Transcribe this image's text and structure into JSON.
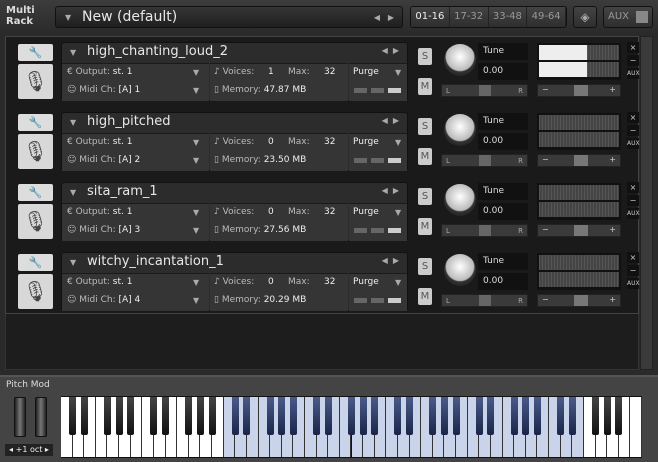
{
  "header": {
    "title_line1": "Multi",
    "title_line2": "Rack",
    "preset_name": "New (default)",
    "pages": [
      "01-16",
      "17-32",
      "33-48",
      "49-64"
    ],
    "active_page": "01-16",
    "aux_label": "AUX"
  },
  "labels": {
    "output": "Output:",
    "midi": "Midi Ch:",
    "voices": "Voices:",
    "max": "Max:",
    "memory": "Memory:",
    "purge": "Purge",
    "solo": "S",
    "mute": "M",
    "tune": "Tune",
    "pan_l": "L",
    "pan_r": "R",
    "vol_minus": "−",
    "vol_plus": "+",
    "close": "×",
    "minimize": "−",
    "aux": "AUX"
  },
  "instruments": [
    {
      "name": "high_chanting_loud_2",
      "output": "st. 1",
      "midi": "[A]  1",
      "voices": "1",
      "max": "32",
      "memory": "47.87 MB",
      "tune": "0.00",
      "level": 0.6
    },
    {
      "name": "high_pitched",
      "output": "st. 1",
      "midi": "[A]  2",
      "voices": "0",
      "max": "32",
      "memory": "23.50 MB",
      "tune": "0.00",
      "level": 0
    },
    {
      "name": "sita_ram_1",
      "output": "st. 1",
      "midi": "[A]  3",
      "voices": "0",
      "max": "32",
      "memory": "27.56 MB",
      "tune": "0.00",
      "level": 0
    },
    {
      "name": "witchy_incantation_1",
      "output": "st. 1",
      "midi": "[A]  4",
      "voices": "0",
      "max": "32",
      "memory": "20.29 MB",
      "tune": "0.00",
      "level": 0
    }
  ],
  "keyboard": {
    "pitch_mod_label": "Pitch Mod",
    "octave_label": "+1 oct",
    "white_keys": 50,
    "highlight_white_start": 14,
    "highlight_white_end": 44
  }
}
